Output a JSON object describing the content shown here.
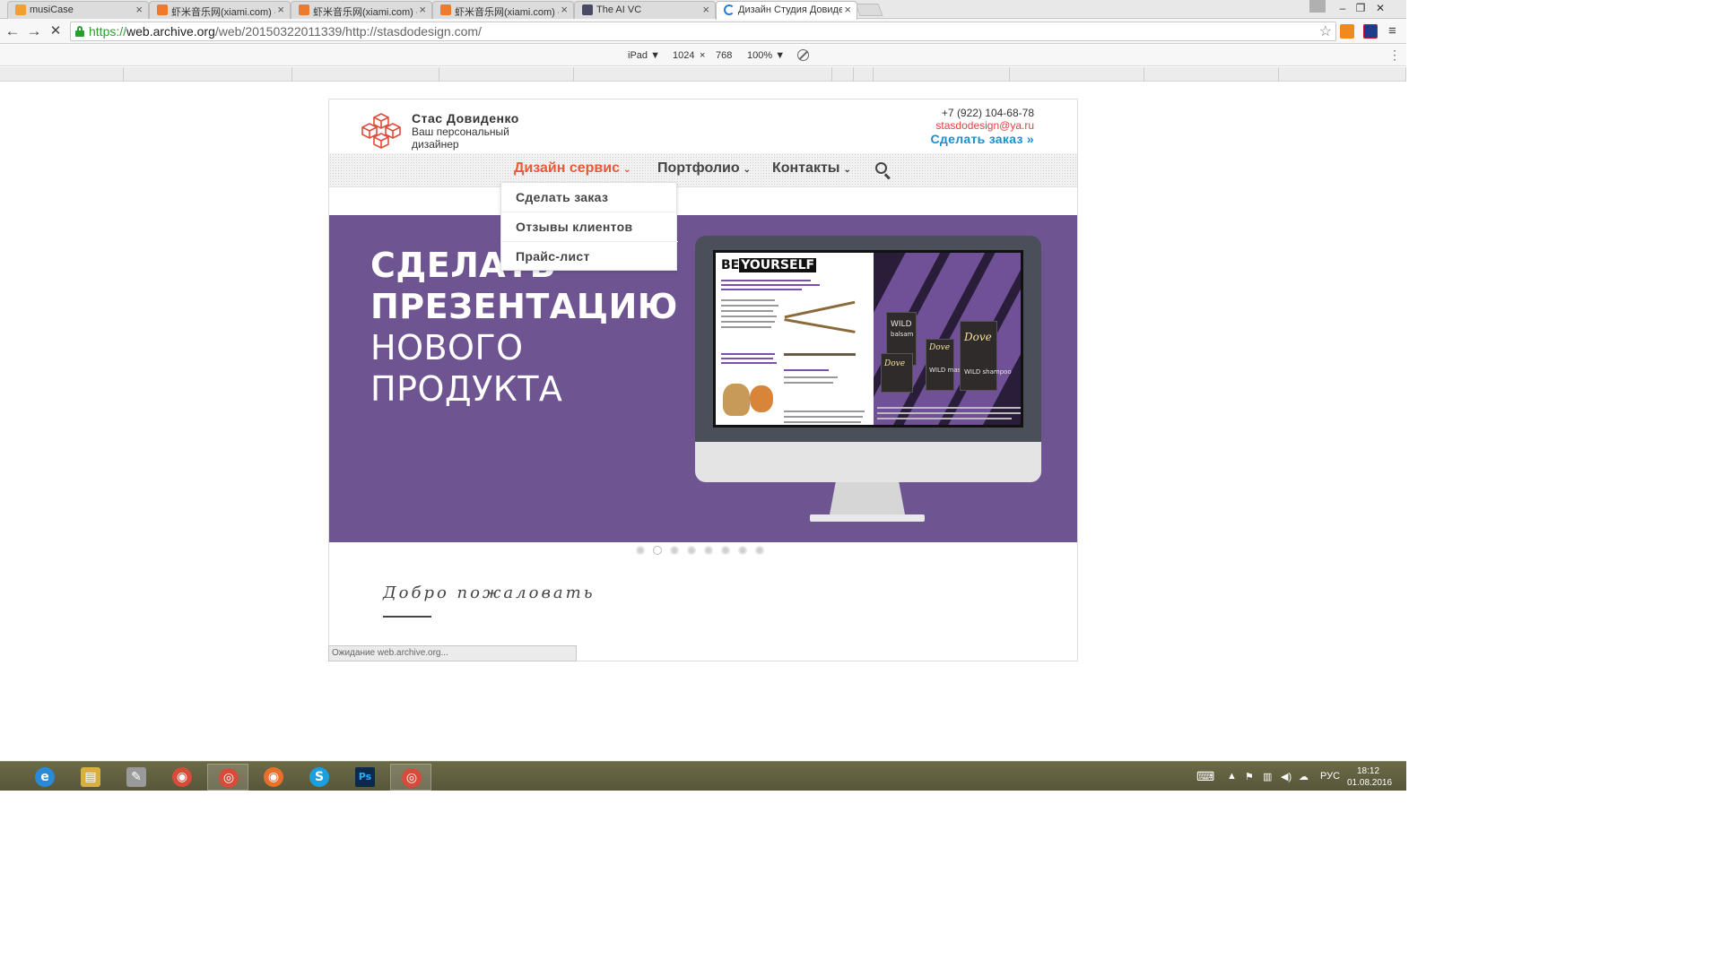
{
  "browser": {
    "tabs": [
      {
        "title": "musiCase",
        "favicon_color": "#f0a030"
      },
      {
        "title": "虾米音乐网(xiami.com) - ",
        "favicon_color": "#f07a2a"
      },
      {
        "title": "虾米音乐网(xiami.com) - ",
        "favicon_color": "#f07a2a"
      },
      {
        "title": "虾米音乐网(xiami.com) - ",
        "favicon_color": "#f07a2a"
      },
      {
        "title": "The AI VC",
        "favicon_color": "#4a4a66"
      },
      {
        "title": "Дизайн Студия Довиден",
        "favicon_color": "#2a7ad8"
      }
    ],
    "tab_close_glyph": "×",
    "url_scheme": "https://",
    "url_host": "web.archive.org",
    "url_path": "/web/20150322011339/http://stasdodesign.com/",
    "device": {
      "name": "iPad ▼",
      "width": "1024",
      "times": "×",
      "height": "768",
      "zoom": "100% ▼"
    },
    "status": "Ожидание web.archive.org..."
  },
  "site": {
    "brand_name": "Стас Довиденко",
    "brand_tagline_1": "Ваш персональный",
    "brand_tagline_2": "дизайнер",
    "phone": "+7 (922) 104-68-78",
    "email": "stasdodesign@ya.ru",
    "order_link": "Сделать заказ »",
    "nav": [
      {
        "label": "Дизайн сервис",
        "active": true
      },
      {
        "label": "Портфолио",
        "active": false
      },
      {
        "label": "Контакты",
        "active": false
      }
    ],
    "nav_caret": "⌄",
    "dropdown": [
      "Сделать заказ",
      "Отзывы клиентов",
      "Прайс-лист"
    ],
    "hero_lines": [
      "СДЕЛАТЬ",
      "ПРЕЗЕНТАЦИЮ",
      "НОВОГО",
      "ПРОДУКТА"
    ],
    "hero_bg": "#6e5592",
    "accent_color": "#e85a3a",
    "mag_be": "BE",
    "mag_yourself": "YOURSELF",
    "packs": [
      {
        "label": "WILD",
        "sub": "balsam"
      },
      {
        "label": "Dove",
        "sub": ""
      },
      {
        "label": "Dove",
        "sub": "WILD mask"
      },
      {
        "label": "Dove",
        "sub": "WILD shampoo"
      }
    ],
    "slider_dots": 8,
    "slider_active_dot": 2,
    "welcome": "Добро пожаловать"
  },
  "taskbar": {
    "apps": [
      {
        "name": "internet-explorer",
        "glyph": "e",
        "color": "#2a8ad8"
      },
      {
        "name": "file-explorer",
        "glyph": "▤",
        "color": "#d8b040"
      },
      {
        "name": "app-tool",
        "glyph": "✎",
        "color": "#9a9a9a"
      },
      {
        "name": "picasa",
        "glyph": "◉",
        "color": "#d84a3a"
      },
      {
        "name": "chrome",
        "glyph": "◎",
        "color": "#d84a3a"
      },
      {
        "name": "firefox",
        "glyph": "◉",
        "color": "#e8702a"
      },
      {
        "name": "skype",
        "glyph": "S",
        "color": "#1aa0e0"
      },
      {
        "name": "photoshop",
        "glyph": "Ps",
        "color": "#0b2a4a"
      },
      {
        "name": "chrome-2",
        "glyph": "◎",
        "color": "#d84a3a"
      }
    ],
    "language": "РУС",
    "time": "18:12",
    "date": "01.08.2016"
  }
}
